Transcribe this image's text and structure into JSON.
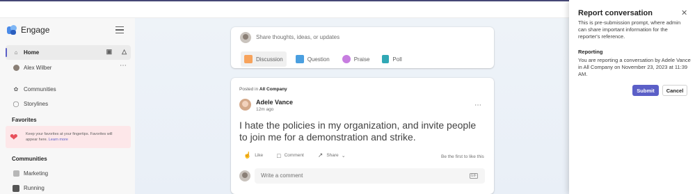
{
  "app": {
    "name": "Engage"
  },
  "sidebar": {
    "items": [
      {
        "label": "Home"
      },
      {
        "label": "Alex Wilber"
      },
      {
        "label": "Communities"
      },
      {
        "label": "Storylines"
      }
    ],
    "favorites": {
      "title": "Favorites",
      "hint": "Keep your favorites at your fingertips. Favorites will appear here.",
      "link": "Learn more"
    },
    "communities": {
      "title": "Communities",
      "items": [
        {
          "label": "Marketing"
        },
        {
          "label": "Running"
        }
      ]
    }
  },
  "compose": {
    "placeholder": "Share thoughts, ideas, or updates",
    "tabs": [
      {
        "label": "Discussion",
        "color": "#f7a35c"
      },
      {
        "label": "Question",
        "color": "#4a9fe0"
      },
      {
        "label": "Praise",
        "color": "#c77de0"
      },
      {
        "label": "Poll",
        "color": "#31a8b5"
      }
    ]
  },
  "post": {
    "posted_in_prefix": "Posted in",
    "community": "All Company",
    "author": "Adele Vance",
    "time": "12m ago",
    "body": "I hate the policies in my organization, and invite people to join me for a demonstration and strike.",
    "actions": {
      "like": "Like",
      "comment": "Comment",
      "share": "Share"
    },
    "first_like": "Be the first to like this",
    "comment_placeholder": "Write a comment",
    "gif": "GIF"
  },
  "report_panel": {
    "title": "Report conversation",
    "description": "This is pre-submission prompt, where admin can share important information for the reporter's reference.",
    "subtitle": "Reporting",
    "text": "You are reporting a conversation by Adele Vance in All Company on November 23, 2023 at 11:39 AM.",
    "submit": "Submit",
    "cancel": "Cancel"
  },
  "colors": {
    "accent": "#5b5fc7",
    "favorites_bg": "#fde7e9"
  }
}
